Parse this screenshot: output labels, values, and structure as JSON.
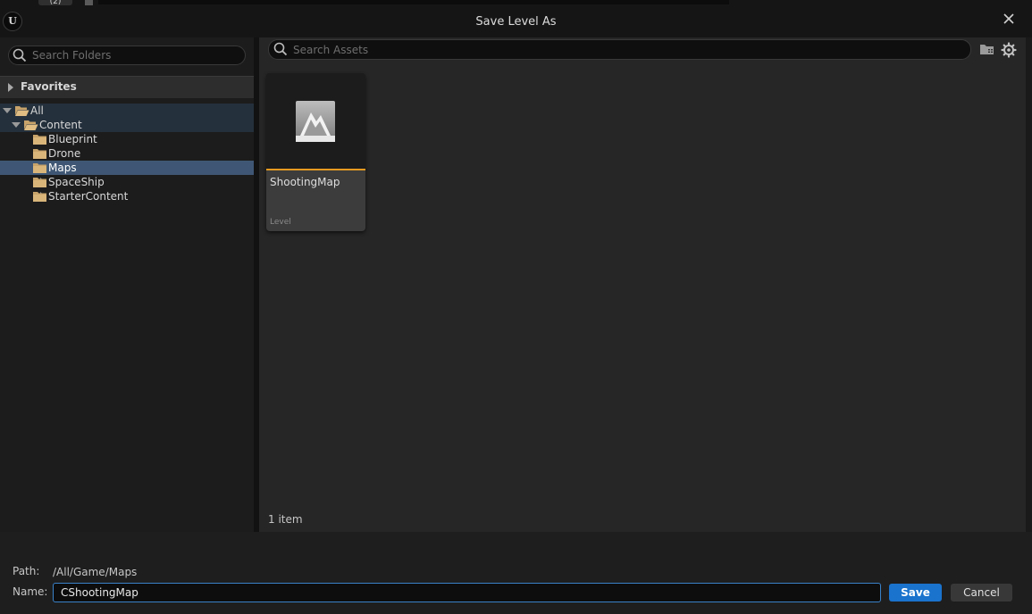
{
  "top_strip": {
    "tab_text": "(2)"
  },
  "window": {
    "title": "Save Level As",
    "logo_text": "U"
  },
  "left_panel": {
    "search_placeholder": "Search Folders",
    "favorites_label": "Favorites",
    "tree": [
      {
        "label": "All",
        "level": 0,
        "expander": "down",
        "state": "parent"
      },
      {
        "label": "Content",
        "level": 1,
        "expander": "down",
        "state": "parent"
      },
      {
        "label": "Blueprint",
        "level": 2,
        "expander": "none",
        "state": "normal"
      },
      {
        "label": "Drone",
        "level": 2,
        "expander": "none",
        "state": "normal"
      },
      {
        "label": "Maps",
        "level": 2,
        "expander": "none",
        "state": "selected"
      },
      {
        "label": "SpaceShip",
        "level": 2,
        "expander": "right",
        "state": "normal"
      },
      {
        "label": "StarterContent",
        "level": 2,
        "expander": "right",
        "state": "normal"
      }
    ]
  },
  "right_panel": {
    "search_placeholder": "Search Assets",
    "assets": [
      {
        "name": "ShootingMap",
        "type": "Level",
        "icon": "level-map-icon"
      }
    ],
    "item_count": "1 item"
  },
  "bottom": {
    "path_label": "Path:",
    "path_value": "/All/Game/Maps",
    "name_label": "Name:",
    "name_value": "CShootingMap",
    "save_label": "Save",
    "cancel_label": "Cancel"
  },
  "colors": {
    "accent": "#1a73cd",
    "asset_bar": "#e59a20",
    "selection": "#3f5774",
    "folder": "#c8a36a"
  }
}
